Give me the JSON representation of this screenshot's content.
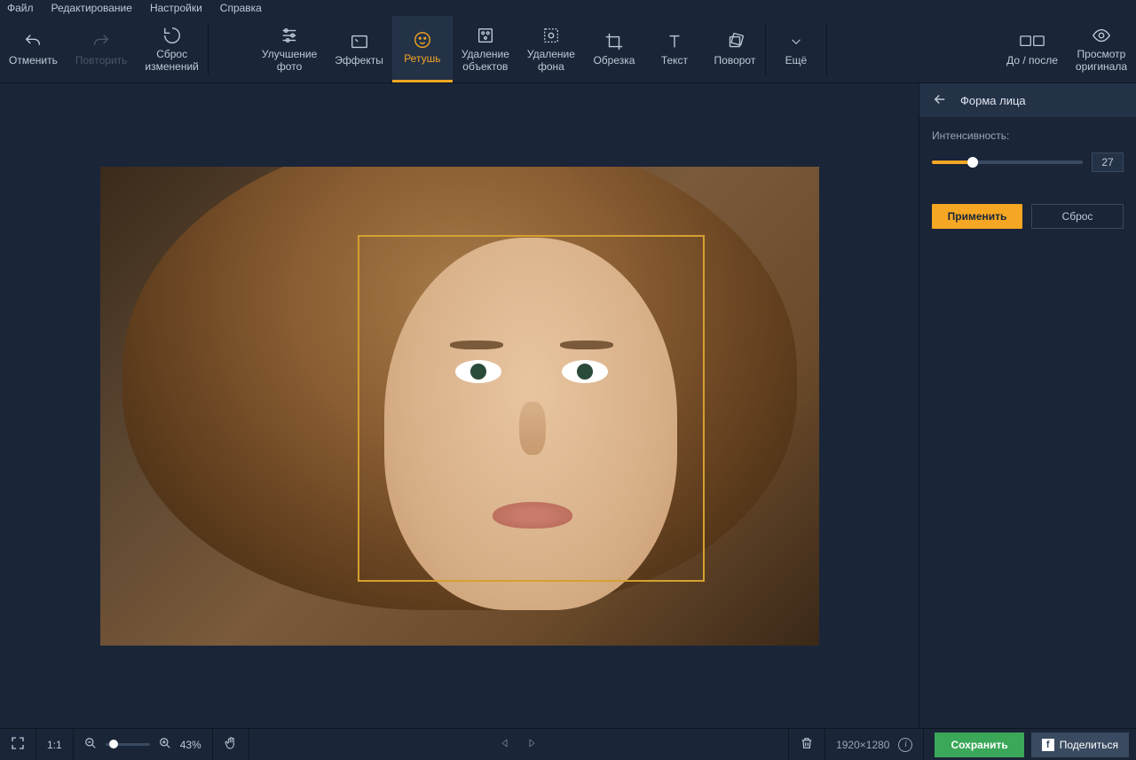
{
  "menu": {
    "file": "Файл",
    "edit": "Редактирование",
    "settings": "Настройки",
    "help": "Справка"
  },
  "toolbar": {
    "undo": "Отменить",
    "redo": "Повторить",
    "reset": "Сброс\nизменений",
    "enhance": "Улучшение\nфото",
    "effects": "Эффекты",
    "retouch": "Ретушь",
    "remove_obj": "Удаление\nобъектов",
    "remove_bg": "Удаление\nфона",
    "crop": "Обрезка",
    "text": "Текст",
    "rotate": "Поворот",
    "more": "Ещё",
    "before_after": "До / после",
    "view_original": "Просмотр\nоригинала"
  },
  "panel": {
    "title": "Форма лица",
    "intensity_label": "Интенсивность:",
    "intensity_value": "27",
    "apply": "Применить",
    "reset": "Сброс"
  },
  "bottom": {
    "scale_1_1": "1:1",
    "zoom_pct": "43%",
    "dimensions": "1920×1280",
    "save": "Сохранить",
    "share": "Поделиться"
  }
}
